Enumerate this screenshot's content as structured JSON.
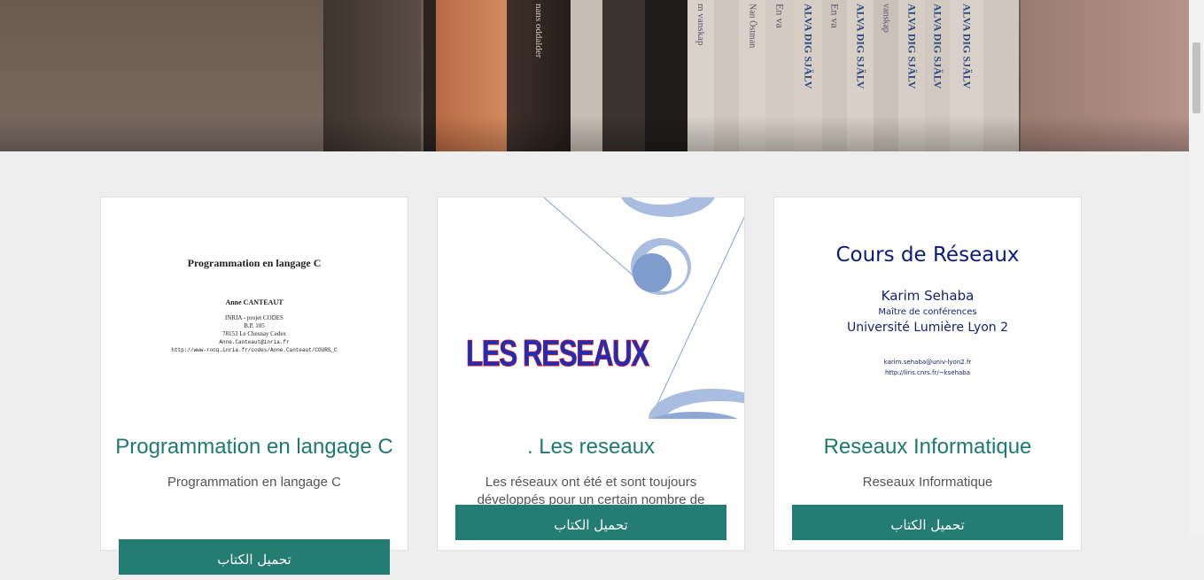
{
  "hero": {
    "spines": [
      "nans oddalder",
      "m vanskap",
      "Nan Östman",
      "En va",
      "ALVA DIG SJÄLV",
      "En va",
      "ALVA DIG SJÄLV",
      "vanskap",
      "ALVA DIG SJÄLV",
      "ALVA DIG SJÄLV",
      "ALVA DIG SJÄLV"
    ]
  },
  "cards": [
    {
      "cover": {
        "title": "Programmation en langage C",
        "author": "Anne CANTEAUT",
        "lines": [
          "INRIA - projet CODES",
          "B.P. 105",
          "78153 Le Chesnay Cedex",
          "Anne.Canteaut@inria.fr",
          "http://www-rocq.inria.fr/codes/Anne.Canteaut/COURS_C"
        ]
      },
      "title": "Programmation en langage C",
      "description": "Programmation en langage C",
      "button": "تحميل الكتاب"
    },
    {
      "cover": {
        "title": "LES RESEAUX"
      },
      "title": ". Les reseaux",
      "description": "Les réseaux ont été et sont toujours développés pour un certain nombre de raisons. Il y en a en fait",
      "button": "تحميل الكتاب"
    },
    {
      "cover": {
        "title": "Cours de Réseaux",
        "author": "Karim Sehaba",
        "role": "Maître de conférences",
        "university": "Université Lumière Lyon 2",
        "email": "karim.sehaba@univ-lyon2.fr",
        "url": "http://liris.cnrs.fr/~ksehaba"
      },
      "title": "Reseaux Informatique",
      "description": "Reseaux Informatique",
      "button": "تحميل الكتاب"
    }
  ]
}
